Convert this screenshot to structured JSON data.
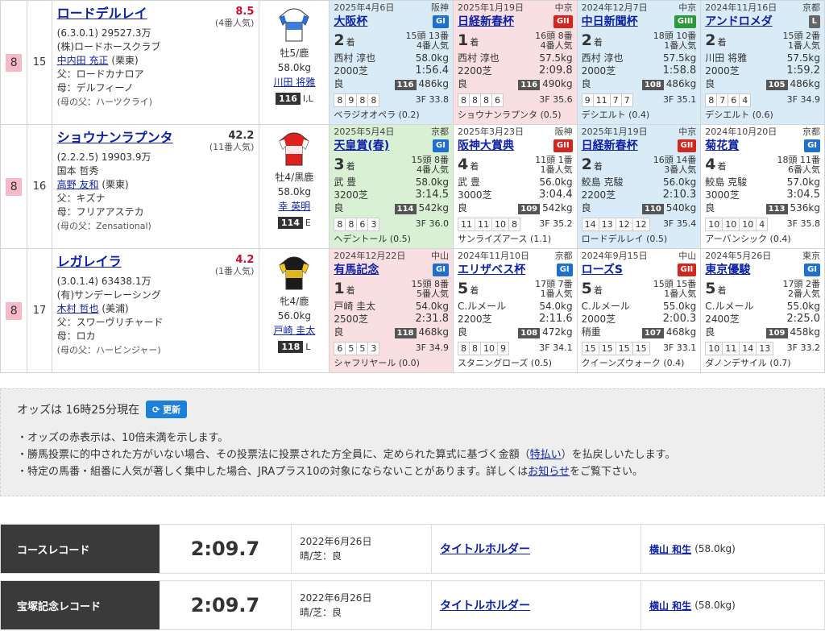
{
  "horses": [
    {
      "waku": "8",
      "umaban": "15",
      "name": "ロードデルレイ",
      "odds": "8.5",
      "odds_color": "red",
      "popularity": "(4番人気)",
      "record": "(6.3.0.1)",
      "prize": "29527.3万",
      "owner": "(株)ロードホースクラブ",
      "trainer": "中内田 充正",
      "trainer_region": "(栗東)",
      "sire": "父：ロードカナロア",
      "dam": "母：デルフィーノ",
      "damsire": "(母の父：ハーツクライ)",
      "sex_age": "牡5/鹿",
      "weight": "58.0kg",
      "jockey": "川田 将雅",
      "rating": "116",
      "rating_note": "I,L",
      "silk": {
        "body": "#ffffff",
        "accent": "#2b6fd6"
      },
      "races": [
        {
          "bg": "blue",
          "date": "2025年4月6日",
          "course": "阪神",
          "name": "大阪杯",
          "grade": "GI",
          "gclass": "g1",
          "place": "2",
          "field": "15頭 13番",
          "pop": "4番人気",
          "jockey": "西村 淳也",
          "jw": "58.0kg",
          "dist": "2000芝",
          "time": "1:56.4",
          "cond": "良",
          "wnum": "116",
          "bw": "486kg",
          "passes": [
            "8",
            "9",
            "8",
            "8"
          ],
          "last3f": "3F 33.8",
          "winner": "ベラジオオペラ (0.2)"
        },
        {
          "bg": "pink",
          "date": "2025年1月19日",
          "course": "中京",
          "name": "日経新春杯",
          "grade": "GII",
          "gclass": "g2",
          "place": "1",
          "field": "16頭 8番",
          "pop": "4番人気",
          "jockey": "西村 淳也",
          "jw": "57.5kg",
          "dist": "2200芝",
          "time": "2:09.8",
          "cond": "良",
          "wnum": "116",
          "bw": "490kg",
          "passes": [
            "8",
            "8",
            "8",
            "6"
          ],
          "last3f": "3F 35.6",
          "winner": "ショウナンラプンタ (0.5)"
        },
        {
          "bg": "blue",
          "date": "2024年12月7日",
          "course": "中京",
          "name": "中日新聞杯",
          "grade": "GIII",
          "gclass": "g3",
          "place": "2",
          "field": "18頭 10番",
          "pop": "1番人気",
          "jockey": "西村 淳也",
          "jw": "57.5kg",
          "dist": "2000芝",
          "time": "1:58.8",
          "cond": "良",
          "wnum": "108",
          "bw": "486kg",
          "passes": [
            "9",
            "11",
            "7",
            "7"
          ],
          "last3f": "3F 35.1",
          "winner": "デシエルト (0.4)"
        },
        {
          "bg": "blue",
          "date": "2024年11月16日",
          "course": "京都",
          "name": "アンドロメダ",
          "grade": "L",
          "gclass": "gl",
          "place": "2",
          "field": "15頭 2番",
          "pop": "1番人気",
          "jockey": "川田 将雅",
          "jw": "57.5kg",
          "dist": "2000芝",
          "time": "1:59.2",
          "cond": "良",
          "wnum": "105",
          "bw": "486kg",
          "passes": [
            "8",
            "7",
            "6",
            "4"
          ],
          "last3f": "3F 34.9",
          "winner": "デシエルト (0.6)"
        }
      ]
    },
    {
      "waku": "8",
      "umaban": "16",
      "name": "ショウナンラプンタ",
      "odds": "42.2",
      "odds_color": "black",
      "popularity": "(11番人気)",
      "record": "(2.2.2.5)",
      "prize": "19903.9万",
      "owner": "国本 哲秀",
      "trainer": "高野 友和",
      "trainer_region": "(栗東)",
      "sire": "父：キズナ",
      "dam": "母：フリアアステカ",
      "damsire": "(母の父：Zensational)",
      "sex_age": "牡4/黒鹿",
      "weight": "58.0kg",
      "jockey": "幸 英明",
      "rating": "114",
      "rating_note": "E",
      "silk": {
        "body": "#e0201c",
        "accent": "#ffffff"
      },
      "races": [
        {
          "bg": "green",
          "date": "2025年5月4日",
          "course": "京都",
          "name": "天皇賞(春)",
          "grade": "GI",
          "gclass": "g1",
          "place": "3",
          "field": "15頭 8番",
          "pop": "4番人気",
          "jockey": "武 豊",
          "jw": "58.0kg",
          "dist": "3200芝",
          "time": "3:14.5",
          "cond": "良",
          "wnum": "114",
          "bw": "542kg",
          "passes": [
            "8",
            "8",
            "6",
            "3"
          ],
          "last3f": "3F 36.0",
          "winner": "ヘデントール (0.5)"
        },
        {
          "bg": "",
          "date": "2025年3月23日",
          "course": "阪神",
          "name": "阪神大賞典",
          "grade": "GII",
          "gclass": "g2",
          "place": "4",
          "field": "11頭 1番",
          "pop": "1番人気",
          "jockey": "武 豊",
          "jw": "56.0kg",
          "dist": "3000芝",
          "time": "3:04.4",
          "cond": "良",
          "wnum": "109",
          "bw": "542kg",
          "passes": [
            "11",
            "11",
            "10",
            "8"
          ],
          "last3f": "3F 35.2",
          "winner": "サンライズアース (1.1)"
        },
        {
          "bg": "blue",
          "date": "2025年1月19日",
          "course": "中京",
          "name": "日経新春杯",
          "grade": "GII",
          "gclass": "g2",
          "place": "2",
          "field": "16頭 14番",
          "pop": "3番人気",
          "jockey": "鮫島 克駿",
          "jw": "56.0kg",
          "dist": "2200芝",
          "time": "2:10.3",
          "cond": "良",
          "wnum": "110",
          "bw": "540kg",
          "passes": [
            "14",
            "13",
            "12",
            "12"
          ],
          "last3f": "3F 35.4",
          "winner": "ロードデルレイ (0.5)"
        },
        {
          "bg": "",
          "date": "2024年10月20日",
          "course": "京都",
          "name": "菊花賞",
          "grade": "GI",
          "gclass": "g1",
          "place": "4",
          "field": "18頭 11番",
          "pop": "6番人気",
          "jockey": "鮫島 克駿",
          "jw": "57.0kg",
          "dist": "3000芝",
          "time": "3:04.5",
          "cond": "良",
          "wnum": "113",
          "bw": "536kg",
          "passes": [
            "10",
            "10",
            "10",
            "4"
          ],
          "last3f": "3F 35.8",
          "winner": "アーバンシック (0.4)"
        }
      ]
    },
    {
      "waku": "8",
      "umaban": "17",
      "name": "レガレイラ",
      "odds": "4.2",
      "odds_color": "red",
      "popularity": "(1番人気)",
      "record": "(3.0.1.4)",
      "prize": "63438.1万",
      "owner": "(有)サンデーレーシング",
      "trainer": "木村 哲也",
      "trainer_region": "(美浦)",
      "sire": "父：スワーヴリチャード",
      "dam": "母：ロカ",
      "damsire": "(母の父：ハービンジャー)",
      "sex_age": "牝4/鹿",
      "weight": "56.0kg",
      "jockey": "戸崎 圭太",
      "rating": "118",
      "rating_note": "L",
      "silk": {
        "body": "#1a1a1a",
        "accent": "#f2c81c"
      },
      "races": [
        {
          "bg": "pink",
          "date": "2024年12月22日",
          "course": "中山",
          "name": "有馬記念",
          "grade": "GI",
          "gclass": "g1",
          "place": "1",
          "field": "15頭 8番",
          "pop": "5番人気",
          "jockey": "戸崎 圭太",
          "jw": "54.0kg",
          "dist": "2500芝",
          "time": "2:31.8",
          "cond": "良",
          "wnum": "118",
          "bw": "468kg",
          "passes": [
            "6",
            "5",
            "5",
            "3"
          ],
          "last3f": "3F 34.9",
          "winner": "シャフリヤール (0.0)"
        },
        {
          "bg": "",
          "date": "2024年11月10日",
          "course": "京都",
          "name": "エリザベス杯",
          "grade": "GI",
          "gclass": "g1",
          "place": "5",
          "field": "17頭 7番",
          "pop": "1番人気",
          "jockey": "C.ルメール",
          "jw": "54.0kg",
          "dist": "2200芝",
          "time": "2:11.6",
          "cond": "良",
          "wnum": "108",
          "bw": "472kg",
          "passes": [
            "8",
            "8",
            "10",
            "9"
          ],
          "last3f": "3F 34.1",
          "winner": "スタニングローズ (0.5)"
        },
        {
          "bg": "",
          "date": "2024年9月15日",
          "course": "中山",
          "name": "ローズS",
          "grade": "GII",
          "gclass": "g2",
          "place": "5",
          "field": "15頭 15番",
          "pop": "1番人気",
          "jockey": "C.ルメール",
          "jw": "55.0kg",
          "dist": "2000芝",
          "time": "2:00.3",
          "cond": "稍重",
          "wnum": "107",
          "bw": "468kg",
          "passes": [
            "15",
            "15",
            "15",
            "15"
          ],
          "last3f": "3F 33.1",
          "winner": "クイーンズウォーク (0.4)"
        },
        {
          "bg": "",
          "date": "2024年5月26日",
          "course": "東京",
          "name": "東京優駿",
          "grade": "GI",
          "gclass": "g1",
          "place": "5",
          "field": "17頭 2番",
          "pop": "2番人気",
          "jockey": "C.ルメール",
          "jw": "55.0kg",
          "dist": "2400芝",
          "time": "2:25.0",
          "cond": "良",
          "wnum": "109",
          "bw": "458kg",
          "passes": [
            "10",
            "11",
            "14",
            "13"
          ],
          "last3f": "3F 33.2",
          "winner": "ダノンデサイル (0.7)"
        }
      ]
    }
  ],
  "place_suffix": "着",
  "odds_panel": {
    "heading": "オッズは 16時25分現在",
    "refresh": "更新",
    "note1": "・オッズの赤表示は、10倍未満を示します。",
    "note2_a": "・勝馬投票に的中された方がいない場合、その投票法に投票された方全員に、定められた算式に基づく金額（",
    "note2_link": "特払い",
    "note2_b": "）を払戻しいたします。",
    "note3_a": "・特定の馬番・組番に人気が著しく集中した場合、JRAプラス10の対象にならないことがあります。詳しくは",
    "note3_link": "お知らせ",
    "note3_b": "をご覧下さい。"
  },
  "records": [
    {
      "label": "コースレコード",
      "time": "2:09.7",
      "date": "2022年6月26日",
      "cond": "晴/芝：良",
      "horse": "タイトルホルダー",
      "jockey": "横山 和生",
      "weight": "(58.0kg)"
    },
    {
      "label": "宝塚記念レコード",
      "time": "2:09.7",
      "date": "2022年6月26日",
      "cond": "晴/芝：良",
      "horse": "タイトルホルダー",
      "jockey": "横山 和生",
      "weight": "(58.0kg)"
    }
  ]
}
